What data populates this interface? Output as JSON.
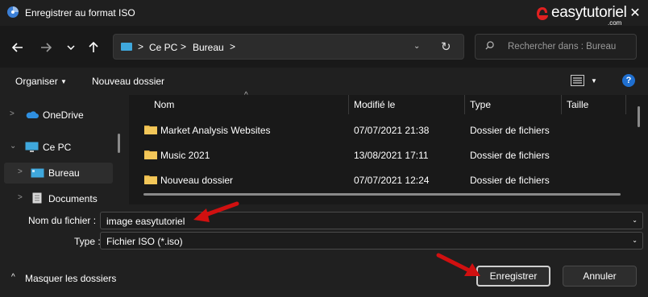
{
  "window": {
    "title": "Enregistrer au format ISO",
    "close_icon": "close-icon"
  },
  "logo": {
    "text": "easytutoriel",
    "sub": ".com"
  },
  "nav": {
    "back_icon": "arrow-left-icon",
    "forward_icon": "arrow-right-icon",
    "recent_icon": "chevron-down-icon",
    "up_icon": "arrow-up-icon"
  },
  "address": {
    "segments": [
      "Ce PC",
      "Bureau"
    ],
    "sep": ">",
    "dropdown": "⌄",
    "refresh": "↻"
  },
  "search": {
    "placeholder": "Rechercher dans : Bureau"
  },
  "toolbar": {
    "organize": "Organiser",
    "new_folder": "Nouveau dossier",
    "help": "?"
  },
  "sidebar": {
    "items": [
      {
        "label": "OneDrive",
        "chevron": ">"
      },
      {
        "label": "Ce PC",
        "chevron": "⌄"
      },
      {
        "label": "Bureau",
        "chevron": ">"
      },
      {
        "label": "Documents",
        "chevron": ">"
      }
    ]
  },
  "filelist": {
    "columns": [
      "Nom",
      "Modifié le",
      "Type",
      "Taille"
    ],
    "rows": [
      {
        "name": "Market Analysis Websites",
        "modified": "07/07/2021 21:38",
        "type": "Dossier de fichiers"
      },
      {
        "name": "Music 2021",
        "modified": "13/08/2021 17:11",
        "type": "Dossier de fichiers"
      },
      {
        "name": "Nouveau dossier",
        "modified": "07/07/2021 12:24",
        "type": "Dossier de fichiers"
      }
    ]
  },
  "form": {
    "filename_label": "Nom du fichier :",
    "filename_value": "image easytutoriel",
    "type_label": "Type :",
    "type_value": "Fichier ISO (*.iso)"
  },
  "footer": {
    "hide_folders": "Masquer les dossiers",
    "save": "Enregistrer",
    "cancel": "Annuler"
  },
  "colors": {
    "accent": "#1f6fd0",
    "folder": "#e8b84a",
    "annotation_arrow": "#d01010"
  }
}
